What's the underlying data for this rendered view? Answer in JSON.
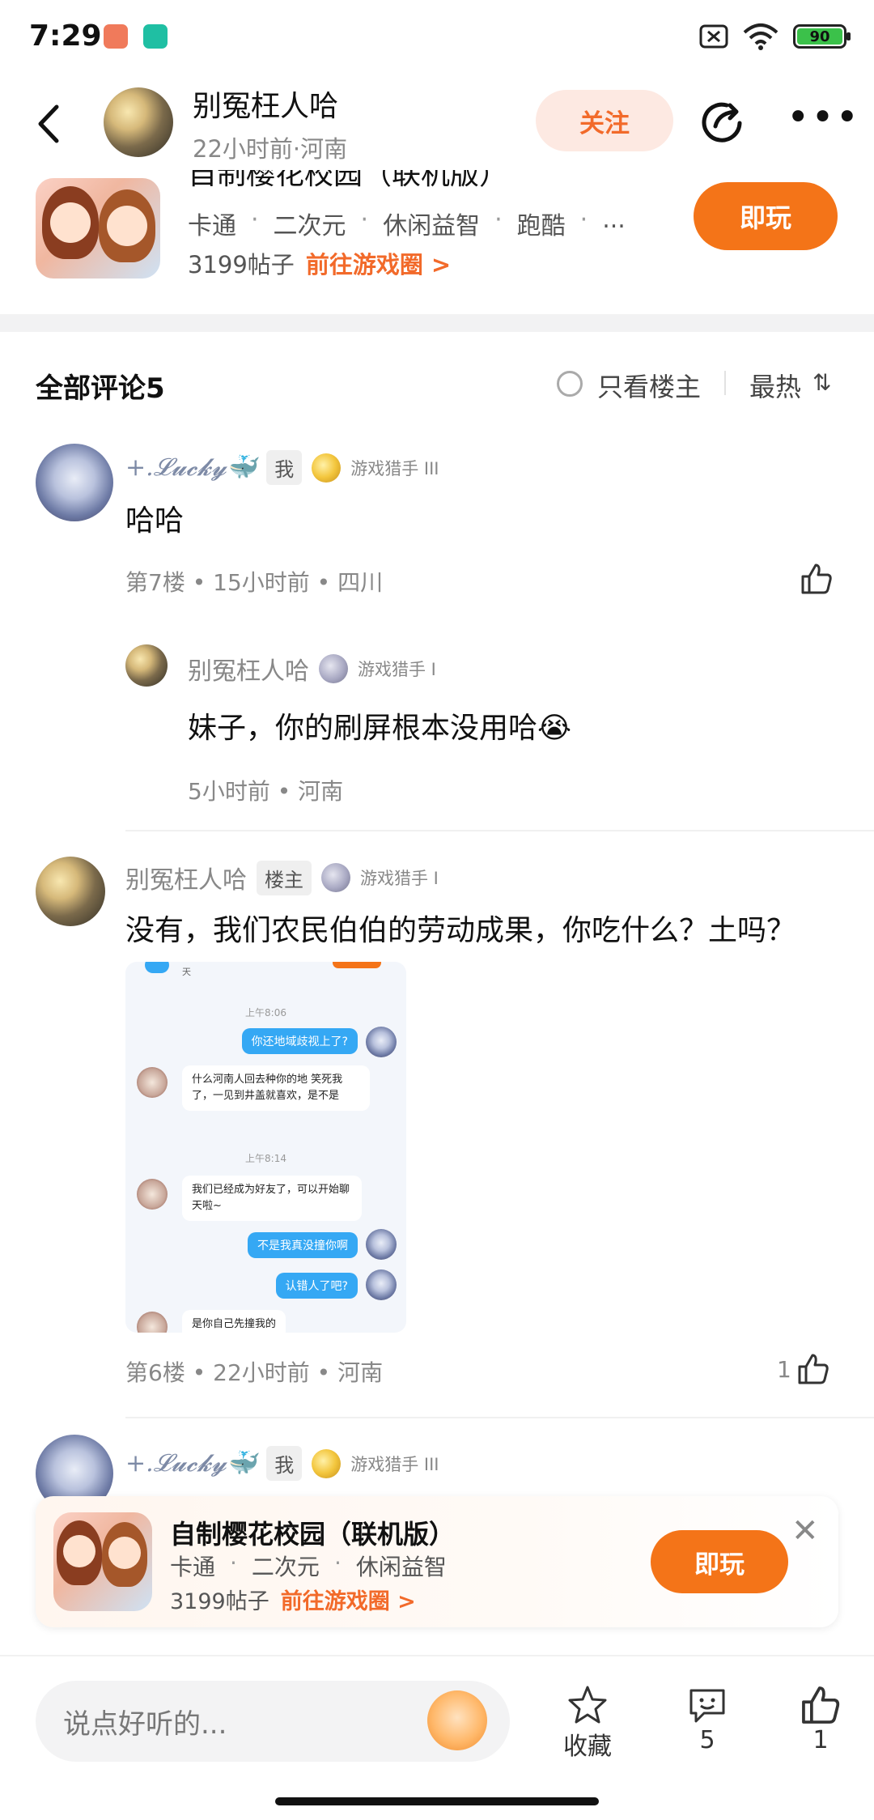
{
  "status_bar": {
    "time": "7:29",
    "battery": "90"
  },
  "header": {
    "author": "别冤枉人哈",
    "meta": "22小时前·河南",
    "follow_label": "关注"
  },
  "game_top": {
    "title": "自制樱花校园（联机版）",
    "tags": [
      "卡通",
      "二次元",
      "休闲益智",
      "跑酷",
      "..."
    ],
    "posts": "3199帖子",
    "circle_link": "前往游戏圈 >",
    "play_label": "即玩"
  },
  "comments_header": {
    "title": "全部评论5",
    "only_host": "只看楼主",
    "sort": "最热",
    "sort_icon": "⇅"
  },
  "comments": [
    {
      "username": "+.𝓛𝓾𝓬𝓴𝔂🐳",
      "tag": "我",
      "level": "游戏猎手 III",
      "text": "哈哈",
      "meta": "第7楼 • 15小时前 • 四川",
      "reply": {
        "username": "别冤枉人哈",
        "level": "游戏猎手 I",
        "text": "妹子，你的刷屏根本没用哈😭",
        "meta": "5小时前 • 河南"
      }
    },
    {
      "username": "别冤枉人哈",
      "tag": "楼主",
      "level": "游戏猎手 I",
      "text": "没有，我们农民伯伯的劳动成果，你吃什么？土吗？",
      "meta": "第6楼 • 22小时前 • 河南",
      "likes": "1",
      "screenshot": {
        "top_text": "天",
        "time1": "上午8:06",
        "msg1": "你还地域歧视上了?",
        "msg2": "什么河南人回去种你的地 笑死我了，一见到井盖就喜欢，是不是",
        "time2": "上午8:14",
        "msg3": "我们已经成为好友了，可以开始聊天啦~",
        "msg4": "不是我真没撞你啊",
        "msg5": "认错人了吧?",
        "msg6": "是你自己先撞我的"
      }
    },
    {
      "username": "+.𝓛𝓾𝓬𝓴𝔂🐳",
      "tag": "我",
      "level": "游戏猎手 III"
    }
  ],
  "banner": {
    "title": "自制樱花校园（联机版）",
    "tags": [
      "卡通",
      "二次元",
      "休闲益智"
    ],
    "posts": "3199帖子",
    "circle_link": "前往游戏圈 >",
    "play_label": "即玩"
  },
  "bottom_bar": {
    "input_placeholder": "说点好听的...",
    "collect_label": "收藏",
    "comment_count": "5",
    "like_count": "1"
  },
  "colors": {
    "accent": "#f47418",
    "follow_bg": "#fde9e2",
    "link": "#f26a2a"
  }
}
